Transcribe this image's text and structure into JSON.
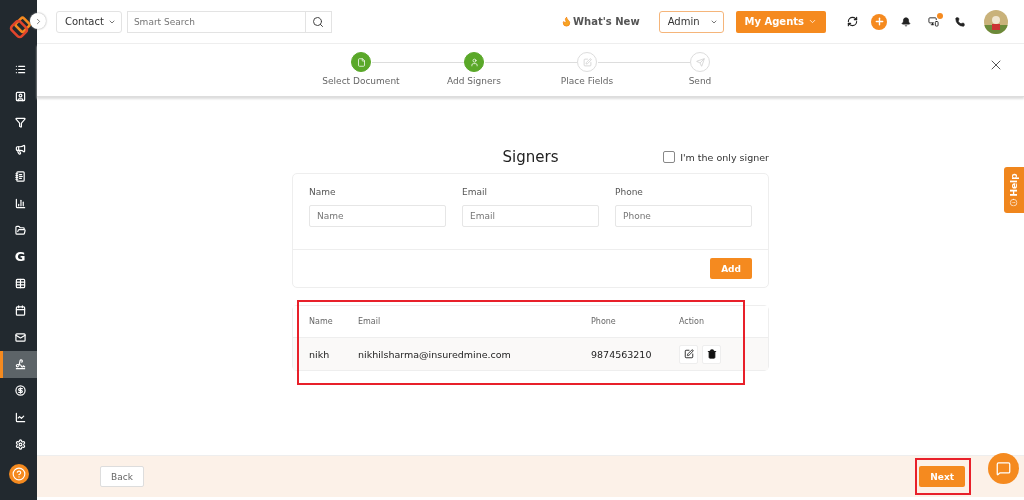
{
  "sidebar": {
    "items": [
      {
        "kind": "icon",
        "selected": false
      },
      {
        "kind": "icon",
        "selected": false
      },
      {
        "kind": "icon",
        "selected": false
      },
      {
        "kind": "icon",
        "selected": false
      },
      {
        "kind": "icon",
        "selected": false
      },
      {
        "kind": "icon",
        "selected": false
      },
      {
        "kind": "icon",
        "selected": false
      },
      {
        "kind": "letter",
        "label": "G",
        "selected": false
      },
      {
        "kind": "icon",
        "selected": false
      },
      {
        "kind": "icon",
        "selected": false
      },
      {
        "kind": "icon",
        "selected": false
      },
      {
        "kind": "icon",
        "selected": true
      },
      {
        "kind": "icon",
        "selected": false
      },
      {
        "kind": "icon",
        "selected": false
      },
      {
        "kind": "icon",
        "selected": false
      }
    ]
  },
  "topbar": {
    "contact_select": "Contact",
    "search": {
      "placeholder": "Smart Search"
    },
    "whats_new": "What's New",
    "role_select": "Admin",
    "agents_button": "My Agents",
    "notification_dot": true
  },
  "stepper": [
    {
      "label": "Select Document",
      "completed": true
    },
    {
      "label": "Add Signers",
      "completed": true
    },
    {
      "label": "Place Fields",
      "completed": false
    },
    {
      "label": "Send",
      "completed": false
    }
  ],
  "signers": {
    "title": "Signers",
    "only_signer": {
      "label": "I'm the only signer",
      "checked": false
    },
    "form": {
      "fields": [
        {
          "label": "Name",
          "placeholder": "Name"
        },
        {
          "label": "Email",
          "placeholder": "Email"
        },
        {
          "label": "Phone",
          "placeholder": "Phone"
        }
      ],
      "add_button": "Add"
    },
    "table": {
      "columns": [
        "Name",
        "Email",
        "Phone",
        "Action"
      ],
      "rows": [
        {
          "name": "nikh",
          "email": "nikhilsharma@insuredmine.com",
          "phone": "9874563210"
        }
      ]
    }
  },
  "footer": {
    "back_button": "Back",
    "next_button": "Next"
  },
  "help_tab": "Help"
}
